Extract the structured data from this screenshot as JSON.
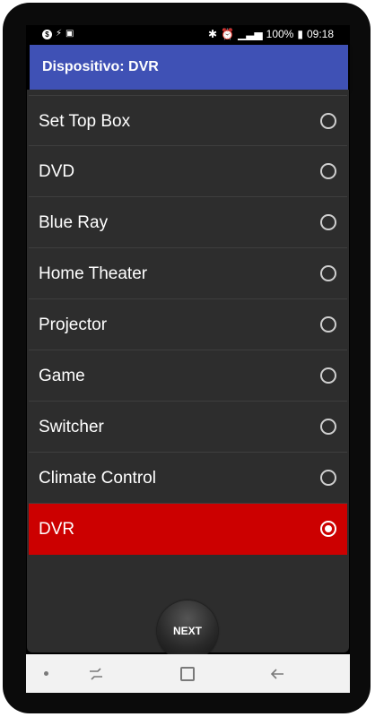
{
  "status": {
    "time": "09:18",
    "battery": "100%",
    "left_icons": [
      "s-circle-icon",
      "flash-icon",
      "gallery-icon"
    ],
    "right_icons": [
      "bluetooth-icon",
      "alarm-icon",
      "signal-icon",
      "battery-icon"
    ]
  },
  "app_bar": {
    "title": "Dispositivo: DVR"
  },
  "device_list": {
    "items": [
      {
        "label": "Set Top Box",
        "selected": false
      },
      {
        "label": "DVD",
        "selected": false
      },
      {
        "label": "Blue Ray",
        "selected": false
      },
      {
        "label": "Home Theater",
        "selected": false
      },
      {
        "label": "Projector",
        "selected": false
      },
      {
        "label": "Game",
        "selected": false
      },
      {
        "label": "Switcher",
        "selected": false
      },
      {
        "label": "Climate Control",
        "selected": false
      },
      {
        "label": "DVR",
        "selected": true
      }
    ]
  },
  "actions": {
    "next_label": "NEXT"
  },
  "nav_bar": {
    "icons": [
      "dot-icon",
      "recent-apps-icon",
      "home-icon",
      "back-icon"
    ]
  },
  "colors": {
    "app_bar": "#3f51b5",
    "selected_row": "#cc0000",
    "list_background": "#2d2d2d",
    "nav_background": "#f2f2f2"
  }
}
